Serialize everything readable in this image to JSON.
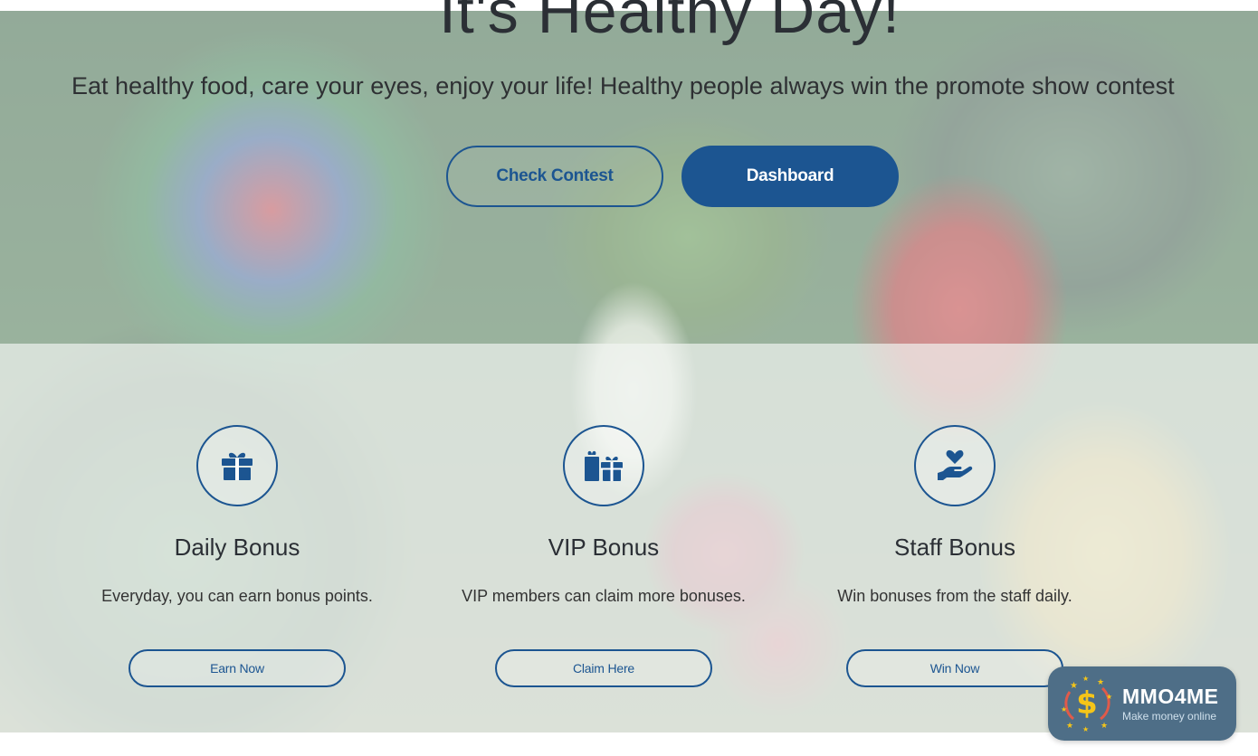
{
  "hero": {
    "title": "It's Healthy Day!",
    "subtitle": "Eat healthy food, care your eyes, enjoy your life! Healthy people always win the promote show contest",
    "buttons": {
      "check_contest": "Check Contest",
      "dashboard": "Dashboard"
    }
  },
  "features": [
    {
      "icon": "gift-icon",
      "title": "Daily Bonus",
      "description": "Everyday, you can earn bonus points.",
      "button": "Earn Now"
    },
    {
      "icon": "gifts-icon",
      "title": "VIP Bonus",
      "description": "VIP members can claim more bonuses.",
      "button": "Claim Here"
    },
    {
      "icon": "hand-holding-heart-icon",
      "title": "Staff Bonus",
      "description": "Win bonuses from the staff daily.",
      "button": "Win Now"
    }
  ],
  "logo": {
    "name": "MMO4ME",
    "tagline": "Make money online"
  },
  "colors": {
    "accent": "#1c5591",
    "text_dark": "#2b2f35",
    "logo_bg": "#4e6e87"
  }
}
